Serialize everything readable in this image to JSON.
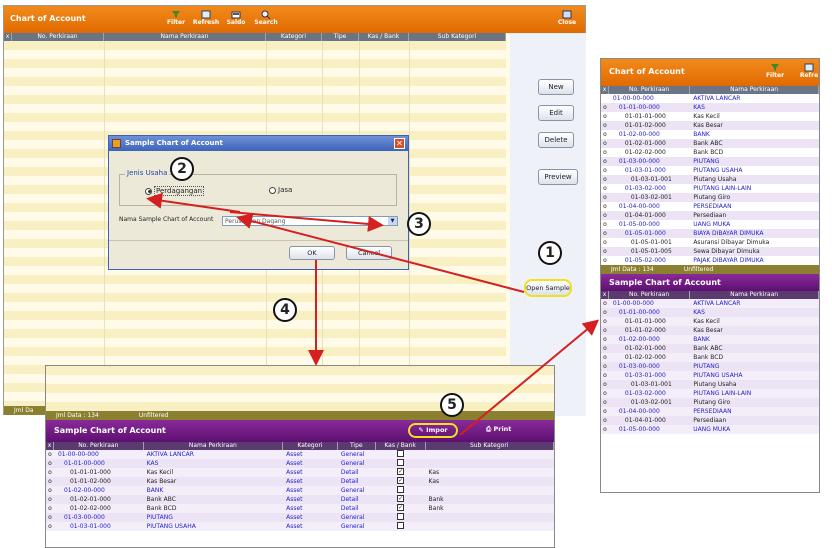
{
  "main": {
    "title": "Chart of Account",
    "toolbar": [
      {
        "label": "Filter",
        "icon": "filter-icon"
      },
      {
        "label": "Refresh",
        "icon": "refresh-icon"
      },
      {
        "label": "Saldo",
        "icon": "saldo-icon"
      },
      {
        "label": "Search",
        "icon": "search-icon"
      }
    ],
    "close_label": "Close",
    "columns": [
      "x",
      "No. Perkiraan",
      "Nama Perkiraan",
      "Kategori",
      "Tipe",
      "Kas / Bank",
      "Sub Kategori"
    ],
    "buttons": {
      "new": "New",
      "edit": "Edit",
      "delete": "Delete",
      "preview": "Preview",
      "open_sample": "Open Sample"
    },
    "status": "Jml Da"
  },
  "dialog": {
    "title": "Sample Chart of Account",
    "group_label": "Jenis Usaha",
    "option1": "Perdagangan",
    "option2": "Jasa",
    "select_label": "Nama Sample Chart of Account",
    "select_value": "Perusahaan Dagang",
    "ok": "OK",
    "cancel": "Cancel"
  },
  "right_panel": {
    "title": "Chart of Account",
    "toolbar": [
      "Filter",
      "Refre"
    ],
    "columns": [
      "x",
      "No. Perkiraan",
      "Nama Perkiraan"
    ],
    "rows": [
      {
        "x": "",
        "no": "01-00-00-000",
        "name": "AKTIVA LANCAR",
        "level": 0,
        "blue": true
      },
      {
        "x": "o",
        "no": "01-01-00-000",
        "name": "KAS",
        "level": 1,
        "blue": true
      },
      {
        "x": "o",
        "no": "01-01-01-000",
        "name": "Kas Kecil",
        "level": 2,
        "blue": false
      },
      {
        "x": "o",
        "no": "01-01-02-000",
        "name": "Kas Besar",
        "level": 2,
        "blue": false
      },
      {
        "x": "o",
        "no": "01-02-00-000",
        "name": "BANK",
        "level": 1,
        "blue": true
      },
      {
        "x": "o",
        "no": "01-02-01-000",
        "name": "Bank ABC",
        "level": 2,
        "blue": false
      },
      {
        "x": "o",
        "no": "01-02-02-000",
        "name": "Bank BCD",
        "level": 2,
        "blue": false
      },
      {
        "x": "o",
        "no": "01-03-00-000",
        "name": "PIUTANG",
        "level": 1,
        "blue": true
      },
      {
        "x": "o",
        "no": "01-03-01-000",
        "name": "PIUTANG USAHA",
        "level": 2,
        "blue": true
      },
      {
        "x": "o",
        "no": "01-03-01-001",
        "name": "Piutang Usaha",
        "level": 3,
        "blue": false
      },
      {
        "x": "o",
        "no": "01-03-02-000",
        "name": "PIUTANG LAIN-LAIN",
        "level": 2,
        "blue": true
      },
      {
        "x": "o",
        "no": "01-03-02-001",
        "name": "Piutang Giro",
        "level": 3,
        "blue": false
      },
      {
        "x": "o",
        "no": "01-04-00-000",
        "name": "PERSEDIAAN",
        "level": 1,
        "blue": true
      },
      {
        "x": "o",
        "no": "01-04-01-000",
        "name": "Persediaan",
        "level": 2,
        "blue": false
      },
      {
        "x": "o",
        "no": "01-05-00-000",
        "name": "UANG MUKA",
        "level": 1,
        "blue": true
      },
      {
        "x": "o",
        "no": "01-05-01-000",
        "name": "BIAYA DIBAYAR DIMUKA",
        "level": 2,
        "blue": true
      },
      {
        "x": "o",
        "no": "01-05-01-001",
        "name": "Asuransi Dibayar Dimuka",
        "level": 3,
        "blue": false
      },
      {
        "x": "o",
        "no": "01-05-01-005",
        "name": "Sewa Dibayar Dimuka",
        "level": 3,
        "blue": false
      },
      {
        "x": "o",
        "no": "01-05-02-000",
        "name": "PAJAK DIBAYAR DIMUKA",
        "level": 2,
        "blue": true
      }
    ],
    "status_left": "Jml Data : 134",
    "status_right": "Unfiltered"
  },
  "right_sample": {
    "title": "Sample Chart of Account",
    "columns": [
      "x",
      "No. Perkiraan",
      "Nama Perkiraan"
    ],
    "rows": [
      {
        "x": "o",
        "no": "01-00-00-000",
        "name": "AKTIVA LANCAR",
        "level": 0,
        "blue": true
      },
      {
        "x": "o",
        "no": "01-01-00-000",
        "name": "KAS",
        "level": 1,
        "blue": true
      },
      {
        "x": "o",
        "no": "01-01-01-000",
        "name": "Kas Kecil",
        "level": 2,
        "blue": false
      },
      {
        "x": "o",
        "no": "01-01-02-000",
        "name": "Kas Besar",
        "level": 2,
        "blue": false
      },
      {
        "x": "o",
        "no": "01-02-00-000",
        "name": "BANK",
        "level": 1,
        "blue": true
      },
      {
        "x": "o",
        "no": "01-02-01-000",
        "name": "Bank ABC",
        "level": 2,
        "blue": false
      },
      {
        "x": "o",
        "no": "01-02-02-000",
        "name": "Bank BCD",
        "level": 2,
        "blue": false
      },
      {
        "x": "o",
        "no": "01-03-00-000",
        "name": "PIUTANG",
        "level": 1,
        "blue": true
      },
      {
        "x": "o",
        "no": "01-03-01-000",
        "name": "PIUTANG USAHA",
        "level": 2,
        "blue": true
      },
      {
        "x": "o",
        "no": "01-03-01-001",
        "name": "Piutang Usaha",
        "level": 3,
        "blue": false
      },
      {
        "x": "o",
        "no": "01-03-02-000",
        "name": "PIUTANG LAIN-LAIN",
        "level": 2,
        "blue": true
      },
      {
        "x": "o",
        "no": "01-03-02-001",
        "name": "Piutang Giro",
        "level": 3,
        "blue": false
      },
      {
        "x": "o",
        "no": "01-04-00-000",
        "name": "PERSEDIAAN",
        "level": 1,
        "blue": true
      },
      {
        "x": "o",
        "no": "01-04-01-000",
        "name": "Persediaan",
        "level": 2,
        "blue": false
      },
      {
        "x": "o",
        "no": "01-05-00-000",
        "name": "UANG MUKA",
        "level": 1,
        "blue": true
      }
    ]
  },
  "bottom": {
    "status_left": "Jml Data : 134",
    "status_right": "Unfiltered",
    "title": "Sample Chart of Account",
    "impor": "Impor",
    "print": "Print",
    "columns": [
      "x",
      "No. Perkiraan",
      "Nama Perkiraan",
      "Kategori",
      "Tipe",
      "Kas / Bank",
      "Sub Kategori"
    ],
    "rows": [
      {
        "x": "o",
        "no": "01-00-00-000",
        "name": "AKTIVA LANCAR",
        "kat": "Asset",
        "tipe": "General",
        "kas": false,
        "sub": "",
        "level": 0,
        "blue": true
      },
      {
        "x": "o",
        "no": "01-01-00-000",
        "name": "KAS",
        "kat": "Asset",
        "tipe": "General",
        "kas": false,
        "sub": "",
        "level": 1,
        "blue": true
      },
      {
        "x": "o",
        "no": "01-01-01-000",
        "name": "Kas Kecil",
        "kat": "Asset",
        "tipe": "Detail",
        "kas": true,
        "sub": "Kas",
        "level": 2,
        "blue": false
      },
      {
        "x": "o",
        "no": "01-01-02-000",
        "name": "Kas Besar",
        "kat": "Asset",
        "tipe": "Detail",
        "kas": true,
        "sub": "Kas",
        "level": 2,
        "blue": false
      },
      {
        "x": "o",
        "no": "01-02-00-000",
        "name": "BANK",
        "kat": "Asset",
        "tipe": "General",
        "kas": false,
        "sub": "",
        "level": 1,
        "blue": true
      },
      {
        "x": "o",
        "no": "01-02-01-000",
        "name": "Bank ABC",
        "kat": "Asset",
        "tipe": "Detail",
        "kas": true,
        "sub": "Bank",
        "level": 2,
        "blue": false
      },
      {
        "x": "o",
        "no": "01-02-02-000",
        "name": "Bank BCD",
        "kat": "Asset",
        "tipe": "Detail",
        "kas": true,
        "sub": "Bank",
        "level": 2,
        "blue": false
      },
      {
        "x": "o",
        "no": "01-03-00-000",
        "name": "PIUTANG",
        "kat": "Asset",
        "tipe": "General",
        "kas": false,
        "sub": "",
        "level": 1,
        "blue": true
      },
      {
        "x": "o",
        "no": "01-03-01-000",
        "name": "PIUTANG USAHA",
        "kat": "Asset",
        "tipe": "General",
        "kas": false,
        "sub": "",
        "level": 2,
        "blue": true
      }
    ]
  },
  "callouts": [
    "1",
    "2",
    "3",
    "4",
    "5"
  ],
  "colors": {
    "orange": "#e87a10",
    "purple": "#6a1a80",
    "arrow": "#d42020",
    "highlight": "#f0e020",
    "olive": "#8a8030"
  }
}
